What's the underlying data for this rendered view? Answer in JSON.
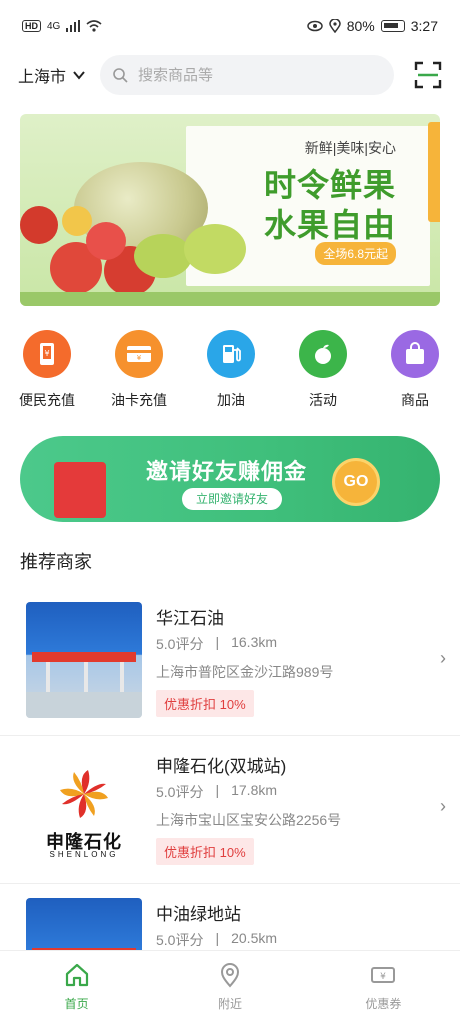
{
  "status_bar": {
    "hd": "HD",
    "network": "4G",
    "battery": "80%",
    "time": "3:27"
  },
  "header": {
    "city": "上海市",
    "search_placeholder": "搜索商品等"
  },
  "banner": {
    "tags": "新鲜|美味|安心",
    "title_line1": "时令鲜果",
    "title_line2": "水果自由",
    "price_pill": "全场6.8元起"
  },
  "quick_actions": [
    {
      "label": "便民充值",
      "icon": "phone-recharge-icon",
      "color": "#f46b2c"
    },
    {
      "label": "油卡充值",
      "icon": "card-recharge-icon",
      "color": "#f6912d"
    },
    {
      "label": "加油",
      "icon": "fuel-pump-icon",
      "color": "#2aa6e8"
    },
    {
      "label": "活动",
      "icon": "apple-icon",
      "color": "#3cb54a"
    },
    {
      "label": "商品",
      "icon": "shopping-bag-icon",
      "color": "#9a69e3"
    }
  ],
  "invite": {
    "title": "邀请好友赚佣金",
    "button": "立即邀请好友",
    "coin": "GO"
  },
  "section_title": "推荐商家",
  "merchants": [
    {
      "name": "华江石油",
      "rating": "5.0评分",
      "distance": "16.3km",
      "address": "上海市普陀区金沙江路989号",
      "discount": "优惠折扣 10%"
    },
    {
      "name": "申隆石化(双城站)",
      "rating": "5.0评分",
      "distance": "17.8km",
      "address": "上海市宝山区宝安公路2256号",
      "discount": "优惠折扣 10%",
      "logo_text": "申隆石化",
      "logo_sub": "SHENLONG"
    },
    {
      "name": "中油绿地站",
      "rating": "5.0评分",
      "distance": "20.5km"
    }
  ],
  "separator": "|",
  "chevron": "›",
  "bottom_nav": [
    {
      "label": "首页",
      "icon": "home-icon",
      "active": true
    },
    {
      "label": "附近",
      "icon": "location-pin-icon",
      "active": false
    },
    {
      "label": "优惠券",
      "icon": "coupon-icon",
      "active": false
    }
  ],
  "colors": {
    "accent_green": "#3aa84a",
    "badge_red": "#e03e3e"
  }
}
